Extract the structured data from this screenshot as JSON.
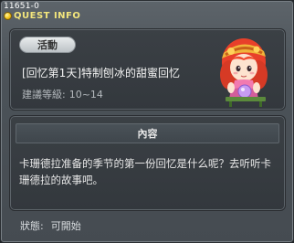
{
  "header": {
    "quest_id": "11651-0",
    "title": "QUEST INFO"
  },
  "quest": {
    "category": "活動",
    "name": "[回忆第1天]特制刨冰的甜蜜回忆",
    "level_label": "建議等級:",
    "level_value": "10~14"
  },
  "content": {
    "header": "內容",
    "text": "卡珊德拉准备的季节的第一份回忆是什么呢？去听听卡珊德拉的故事吧。"
  },
  "status": {
    "label": "狀態:",
    "value": "可開始"
  },
  "npc": {
    "icon": "npc-girl-portrait"
  }
}
